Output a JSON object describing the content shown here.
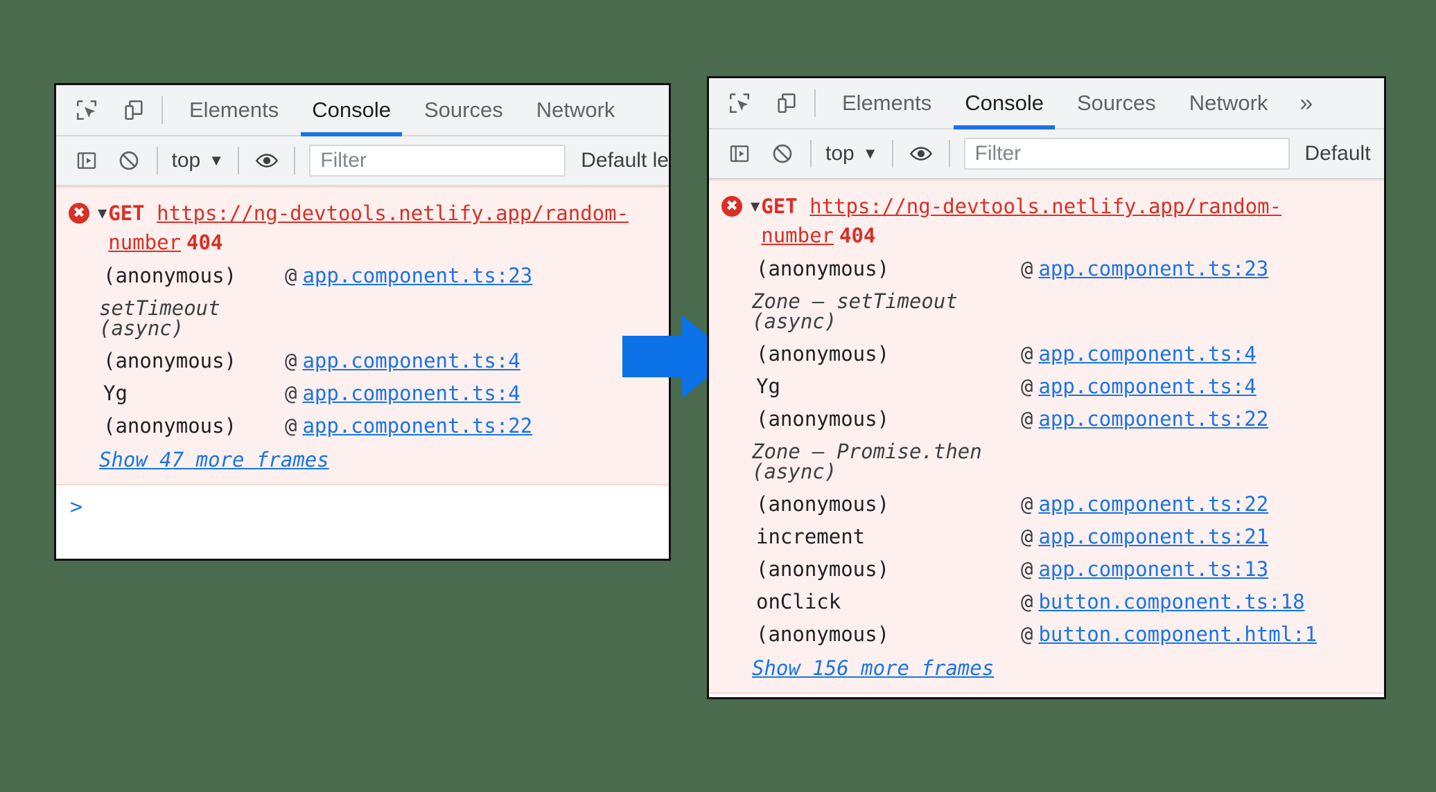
{
  "background_color": "#4a6b4d",
  "arrow": {
    "color": "#0b72e7",
    "name": "right-arrow"
  },
  "panels": {
    "left": {
      "tabs": [
        {
          "label": "Elements",
          "active": false
        },
        {
          "label": "Console",
          "active": true
        },
        {
          "label": "Sources",
          "active": false
        },
        {
          "label": "Network",
          "active": false
        }
      ],
      "toolbar": {
        "inspect_icon": "inspect-element-icon",
        "device_icon": "device-toolbar-icon"
      },
      "filterbar": {
        "sidebar_icon": "console-sidebar-icon",
        "clear_icon": "clear-console-icon",
        "context": "top",
        "caret": "▼",
        "eye_icon": "live-expression-icon",
        "filter_placeholder": "Filter",
        "level_label": "Default le"
      },
      "error": {
        "icon": "error-icon",
        "triangle": "▼",
        "method": "GET",
        "url": "https://ng-devtools.netlify.app/random-number",
        "status": "404"
      },
      "frames": [
        {
          "fn": "(anonymous)",
          "at": "@",
          "loc": "app.component.ts:23",
          "async": false
        },
        {
          "fn": "setTimeout (async)",
          "at": "",
          "loc": "",
          "async": true
        },
        {
          "fn": "(anonymous)",
          "at": "@",
          "loc": "app.component.ts:4",
          "async": false
        },
        {
          "fn": "Yg",
          "at": "@",
          "loc": "app.component.ts:4",
          "async": false
        },
        {
          "fn": "(anonymous)",
          "at": "@",
          "loc": "app.component.ts:22",
          "async": false
        }
      ],
      "show_more": "Show 47 more frames",
      "prompt": ">"
    },
    "right": {
      "tabs": [
        {
          "label": "Elements",
          "active": false
        },
        {
          "label": "Console",
          "active": true
        },
        {
          "label": "Sources",
          "active": false
        },
        {
          "label": "Network",
          "active": false
        }
      ],
      "more_tabs": "»",
      "toolbar": {
        "inspect_icon": "inspect-element-icon",
        "device_icon": "device-toolbar-icon"
      },
      "filterbar": {
        "sidebar_icon": "console-sidebar-icon",
        "clear_icon": "clear-console-icon",
        "context": "top",
        "caret": "▼",
        "eye_icon": "live-expression-icon",
        "filter_placeholder": "Filter",
        "level_label": "Default"
      },
      "error": {
        "icon": "error-icon",
        "triangle": "▼",
        "method": "GET",
        "url": "https://ng-devtools.netlify.app/random-number",
        "status": "404"
      },
      "frames": [
        {
          "fn": "(anonymous)",
          "at": "@",
          "loc": "app.component.ts:23",
          "async": false
        },
        {
          "fn": "Zone — setTimeout (async)",
          "at": "",
          "loc": "",
          "async": true
        },
        {
          "fn": "(anonymous)",
          "at": "@",
          "loc": "app.component.ts:4",
          "async": false
        },
        {
          "fn": "Yg",
          "at": "@",
          "loc": "app.component.ts:4",
          "async": false
        },
        {
          "fn": "(anonymous)",
          "at": "@",
          "loc": "app.component.ts:22",
          "async": false
        },
        {
          "fn": "Zone — Promise.then (async)",
          "at": "",
          "loc": "",
          "async": true
        },
        {
          "fn": "(anonymous)",
          "at": "@",
          "loc": "app.component.ts:22",
          "async": false
        },
        {
          "fn": "increment",
          "at": "@",
          "loc": "app.component.ts:21",
          "async": false
        },
        {
          "fn": "(anonymous)",
          "at": "@",
          "loc": "app.component.ts:13",
          "async": false
        },
        {
          "fn": "onClick",
          "at": "@",
          "loc": "button.component.ts:18",
          "async": false
        },
        {
          "fn": "(anonymous)",
          "at": "@",
          "loc": "button.component.html:1",
          "async": false
        }
      ],
      "show_more": "Show 156 more frames",
      "prompt": ">"
    }
  }
}
